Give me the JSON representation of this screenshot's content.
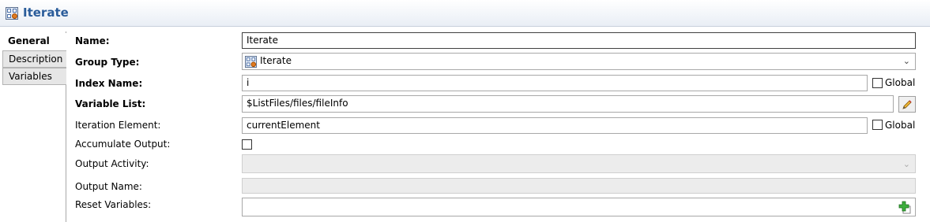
{
  "header": {
    "title": "Iterate",
    "icon": "group-iterate-icon"
  },
  "tabs": [
    {
      "label": "General",
      "active": true
    },
    {
      "label": "Description",
      "active": false
    },
    {
      "label": "Variables",
      "active": false
    }
  ],
  "form": {
    "name": {
      "label": "Name:",
      "value": "Iterate"
    },
    "group_type": {
      "label": "Group Type:",
      "value": "Iterate"
    },
    "index_name": {
      "label": "Index Name:",
      "value": "i",
      "global_label": "Global",
      "global_checked": false
    },
    "variable_list": {
      "label": "Variable List:",
      "value": "$ListFiles/files/fileInfo"
    },
    "iteration_element": {
      "label": "Iteration Element:",
      "value": "currentElement",
      "global_label": "Global",
      "global_checked": false
    },
    "accumulate_output": {
      "label": "Accumulate Output:",
      "checked": false
    },
    "output_activity": {
      "label": "Output Activity:",
      "value": ""
    },
    "output_name": {
      "label": "Output Name:",
      "value": ""
    },
    "reset_variables": {
      "label": "Reset Variables:",
      "value": ""
    }
  }
}
